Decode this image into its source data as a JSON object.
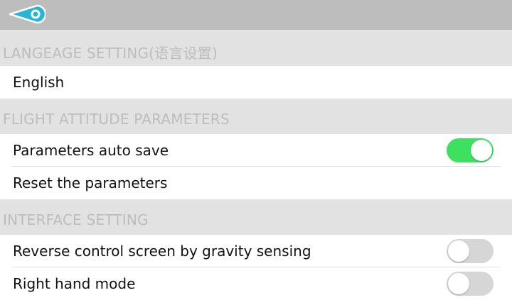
{
  "colors": {
    "toggle_on": "#3ee060",
    "toggle_off": "#d6d6d6",
    "back_icon": "#2ab4d4"
  },
  "icons": {
    "back": "back-arrow-icon"
  },
  "sections": [
    {
      "title": "LANGEAGE SETTING(语言设置)",
      "items": [
        {
          "label": "English"
        }
      ]
    },
    {
      "title": "FLIGHT ATTITUDE PARAMETERS",
      "items": [
        {
          "label": "Parameters auto save",
          "toggle": true
        },
        {
          "label": "Reset the parameters"
        }
      ]
    },
    {
      "title": "INTERFACE SETTING",
      "items": [
        {
          "label": "Reverse control screen by gravity sensing",
          "toggle": false
        },
        {
          "label": "Right hand mode",
          "toggle": false
        }
      ]
    }
  ]
}
